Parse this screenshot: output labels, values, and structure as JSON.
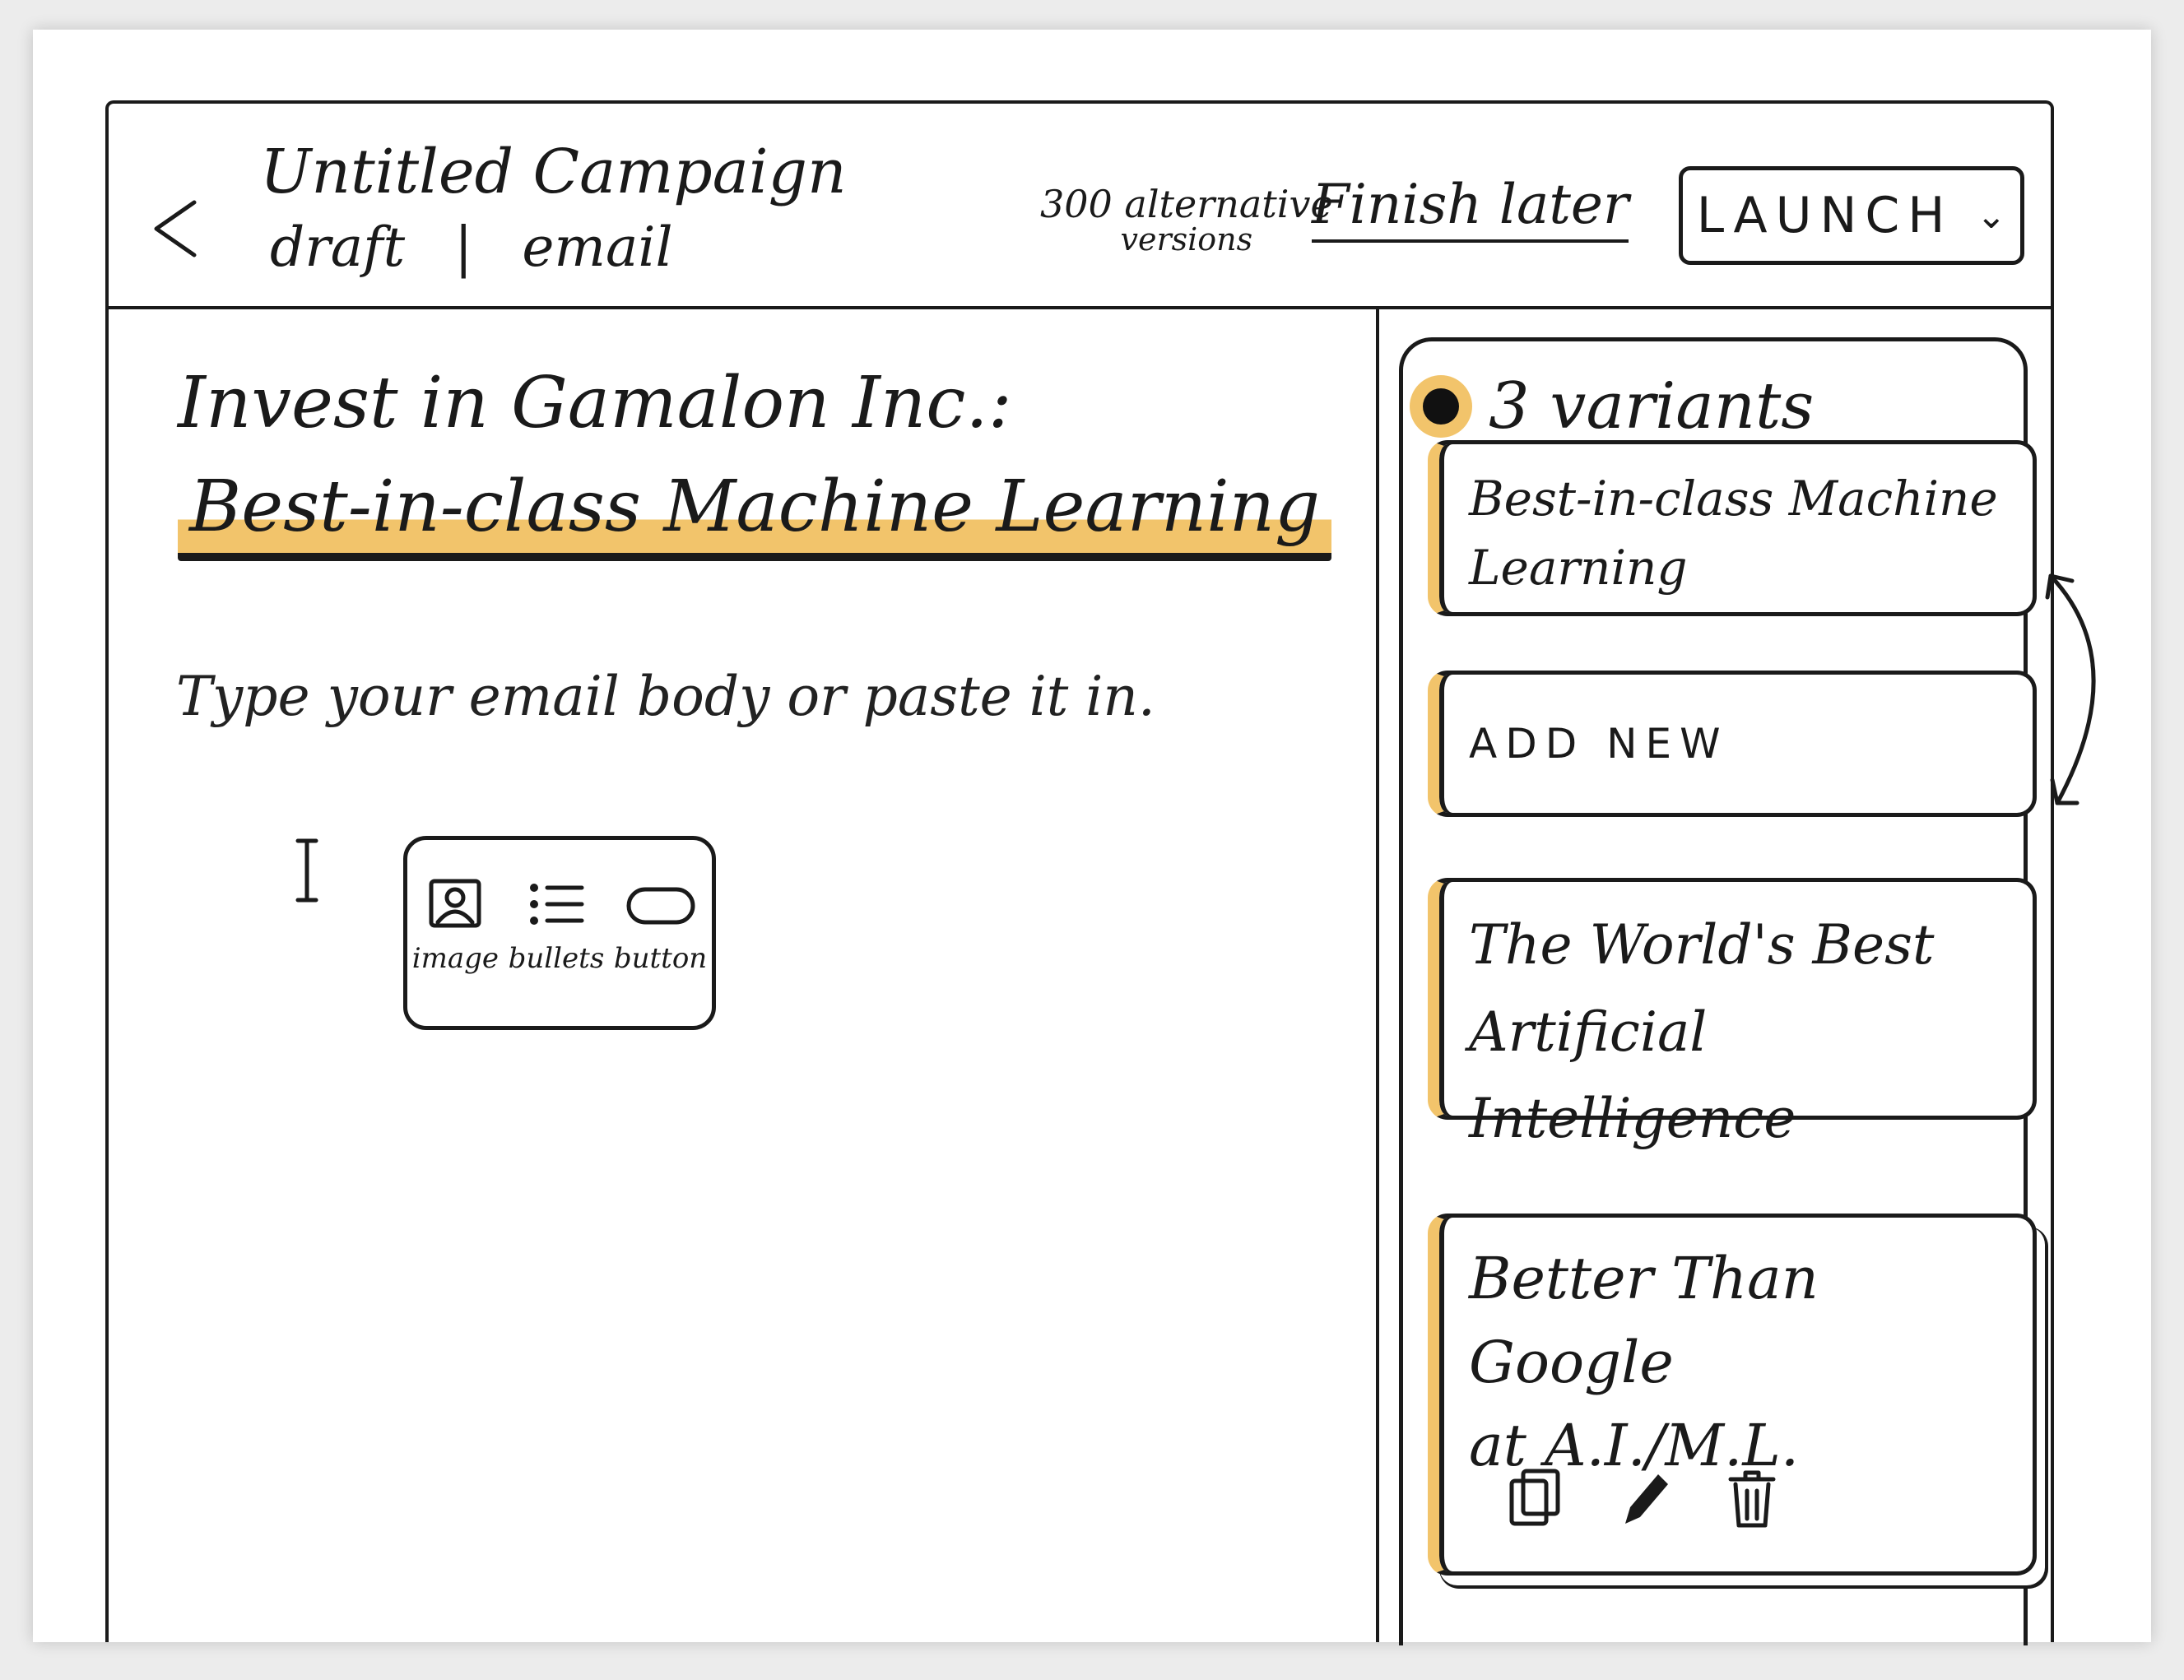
{
  "header": {
    "title": "Untitled Campaign",
    "status": "draft",
    "separator": "|",
    "channel": "email",
    "alt_versions_count": "300 alternative",
    "alt_versions_label": "versions",
    "finish_later_label": "Finish later",
    "launch_label": "LAUNCH",
    "launch_chevron": "⌄"
  },
  "editor": {
    "subject_line1": "Invest in Gamalon Inc.:",
    "subject_line2": "Best-in-class Machine Learning",
    "body_placeholder": "Type your email body or paste it in.",
    "caret": "I",
    "insert_menu": [
      {
        "label": "image",
        "icon": "image-icon"
      },
      {
        "label": "bullets",
        "icon": "bullets-icon"
      },
      {
        "label": "button",
        "icon": "button-icon"
      }
    ]
  },
  "variants": {
    "count_label": "3 variants",
    "items": [
      {
        "text": "Best-in-class Machine Learning"
      },
      {
        "text": "ADD NEW"
      },
      {
        "text_line1": "The World's Best",
        "text_line2": "Artificial Intelligence"
      },
      {
        "text_line1": "Better Than Google",
        "text_line2": "at A.I./M.L."
      }
    ],
    "actions": [
      "duplicate-icon",
      "edit-icon",
      "delete-icon"
    ]
  },
  "colors": {
    "ink": "#1a1a1a",
    "highlight": "#f2c46b",
    "paper": "#ffffff"
  }
}
